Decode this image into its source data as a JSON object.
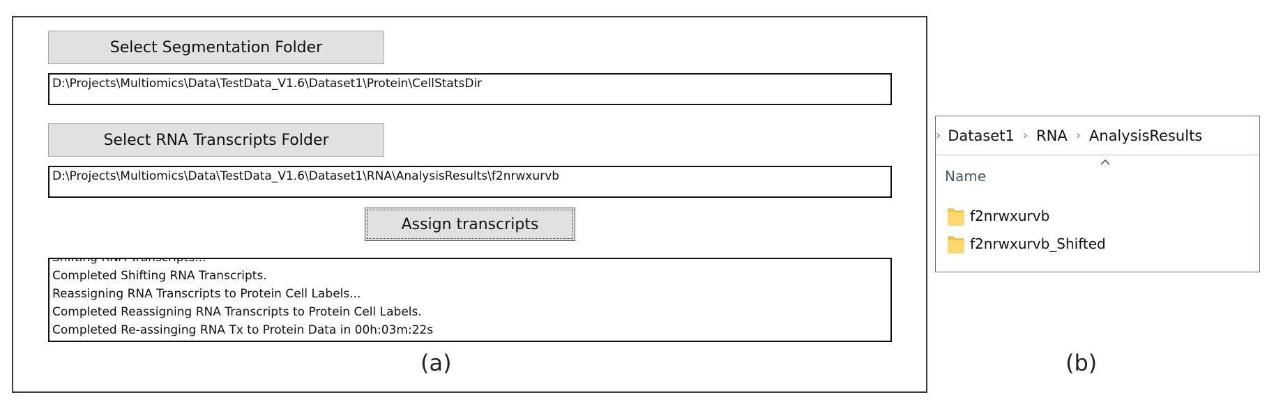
{
  "app": {
    "select_segmentation_label": "Select Segmentation Folder",
    "segmentation_path": "D:\\Projects\\Multiomics\\Data\\TestData_V1.6\\Dataset1\\Protein\\CellStatsDir",
    "select_rna_label": "Select RNA Transcripts Folder",
    "rna_path": "D:\\Projects\\Multiomics\\Data\\TestData_V1.6\\Dataset1\\RNA\\AnalysisResults\\f2nrwxurvb",
    "assign_label": "Assign transcripts",
    "log_lines": [
      "Shifting RNA Transcripts...",
      "Completed Shifting RNA Transcripts.",
      "Reassigning RNA Transcripts to Protein Cell Labels...",
      "Completed Reassigning RNA Transcripts to Protein Cell Labels.",
      "Completed Re-assinging RNA Tx to Protein Data in 00h:03m:22s"
    ]
  },
  "captions": {
    "a": "(a)",
    "b": "(b)"
  },
  "explorer": {
    "breadcrumb": [
      "Dataset1",
      "RNA",
      "AnalysisResults"
    ],
    "separator": "›",
    "column_header": "Name",
    "sort_icon": "chevron-up-icon",
    "folder_icon": "folder-icon",
    "items": [
      {
        "name": "f2nrwxurvb"
      },
      {
        "name": "f2nrwxurvb_Shifted"
      }
    ]
  },
  "colors": {
    "button_face": "#e1e1e1",
    "folder_yellow": "#ffd96b",
    "header_text": "#4a5a6e"
  }
}
